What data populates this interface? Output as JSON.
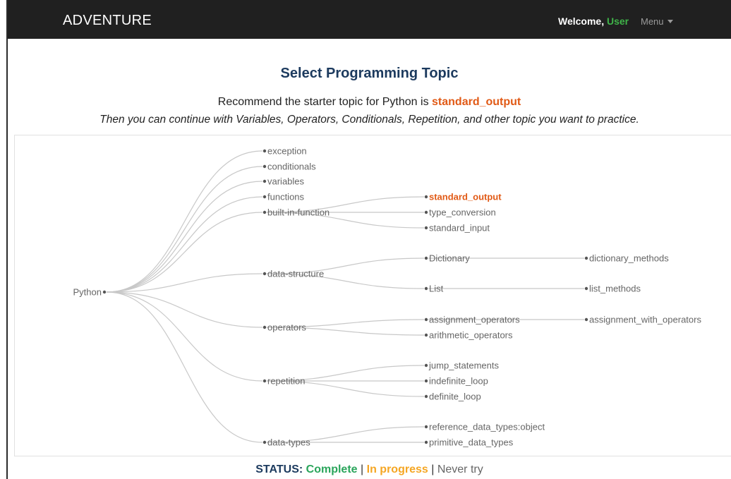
{
  "navbar": {
    "brand": "ADVENTURE",
    "welcome_prefix": "Welcome, ",
    "user_name": "User",
    "menu_label": "Menu"
  },
  "page": {
    "title": "Select Programming Topic",
    "recommend_prefix": "Recommend the starter topic for Python is ",
    "recommend_topic": "standard_output",
    "continue_text": "Then you can continue with Variables, Operators, Conditionals, Repetition, and other topic you want to practice."
  },
  "tree": {
    "root": "Python",
    "recommended": "standard_output",
    "nodes": [
      {
        "id": "exception",
        "label": "exception",
        "parent": "root"
      },
      {
        "id": "conditionals",
        "label": "conditionals",
        "parent": "root"
      },
      {
        "id": "variables",
        "label": "variables",
        "parent": "root"
      },
      {
        "id": "functions",
        "label": "functions",
        "parent": "root"
      },
      {
        "id": "builtin",
        "label": "built-in-function",
        "parent": "root"
      },
      {
        "id": "datastructure",
        "label": "data-structure",
        "parent": "root"
      },
      {
        "id": "operators",
        "label": "operators",
        "parent": "root"
      },
      {
        "id": "repetition",
        "label": "repetition",
        "parent": "root"
      },
      {
        "id": "datatypes",
        "label": "data-types",
        "parent": "root"
      },
      {
        "id": "standard_output",
        "label": "standard_output",
        "parent": "builtin"
      },
      {
        "id": "type_conversion",
        "label": "type_conversion",
        "parent": "builtin"
      },
      {
        "id": "standard_input",
        "label": "standard_input",
        "parent": "builtin"
      },
      {
        "id": "dictionary",
        "label": "Dictionary",
        "parent": "datastructure"
      },
      {
        "id": "list",
        "label": "List",
        "parent": "datastructure"
      },
      {
        "id": "assignment_operators",
        "label": "assignment_operators",
        "parent": "operators"
      },
      {
        "id": "arithmetic_operators",
        "label": "arithmetic_operators",
        "parent": "operators"
      },
      {
        "id": "jump_statements",
        "label": "jump_statements",
        "parent": "repetition"
      },
      {
        "id": "indefinite_loop",
        "label": "indefinite_loop",
        "parent": "repetition"
      },
      {
        "id": "definite_loop",
        "label": "definite_loop",
        "parent": "repetition"
      },
      {
        "id": "reference_data_types",
        "label": "reference_data_types:object",
        "parent": "datatypes"
      },
      {
        "id": "primitive_data_types",
        "label": "primitive_data_types",
        "parent": "datatypes"
      },
      {
        "id": "dictionary_methods",
        "label": "dictionary_methods",
        "parent": "dictionary"
      },
      {
        "id": "list_methods",
        "label": "list_methods",
        "parent": "list"
      },
      {
        "id": "assignment_with_operators",
        "label": "assignment_with_operators",
        "parent": "assignment_operators"
      }
    ]
  },
  "status": {
    "label": "STATUS:",
    "complete": "Complete",
    "in_progress": "In progress",
    "never_try": "Never try",
    "separator": "|",
    "colors": {
      "complete": "#2aa55b",
      "in_progress": "#f5a623",
      "never_try": "#666666",
      "recommended": "#e15a16"
    }
  }
}
